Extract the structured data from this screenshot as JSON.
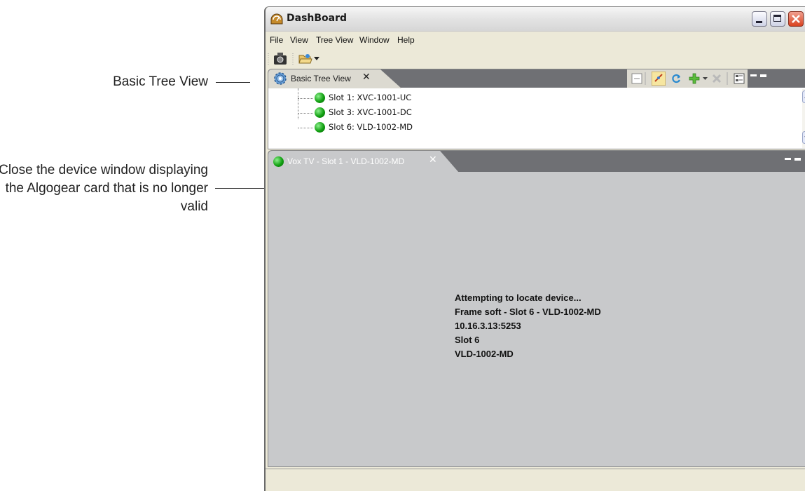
{
  "callouts": {
    "tree_view": "Basic Tree View",
    "device_window": "Close the device window displaying the Algogear card that is no longer valid"
  },
  "window": {
    "title": "DashBoard",
    "app_icon": "dashboard-app-icon"
  },
  "menu": [
    "File",
    "View",
    "Tree View",
    "Window",
    "Help"
  ],
  "toolbar": {
    "icons": [
      "camera-icon",
      "open-folder-icon",
      "dropdown-arrow-icon"
    ]
  },
  "tree_view": {
    "tab_label": "Basic Tree View",
    "close_glyph": "✕",
    "items": [
      {
        "label": "Slot 1: XVC-1001-UC",
        "status_color": "#11a011"
      },
      {
        "label": "Slot 3: XVC-1001-DC",
        "status_color": "#11a011"
      },
      {
        "label": "Slot 6: VLD-1002-MD",
        "status_color": "#11a011"
      }
    ],
    "tool_icons": [
      "collapse-icon",
      "link-icon",
      "refresh-icon",
      "add-icon",
      "delete-icon",
      "tree-options-icon"
    ]
  },
  "device_window": {
    "tab_label": "Vox TV - Slot 1 - VLD-1002-MD",
    "close_glyph": "✕",
    "messages": [
      "Attempting to locate device...",
      "Frame soft - Slot 6 - VLD-1002-MD",
      "10.16.3.13:5253",
      "Slot 6",
      "VLD-1002-MD"
    ]
  },
  "colors": {
    "panel_header": "#6f7074",
    "status_ok": "#11a011",
    "device_bg": "#c8c9cb"
  }
}
